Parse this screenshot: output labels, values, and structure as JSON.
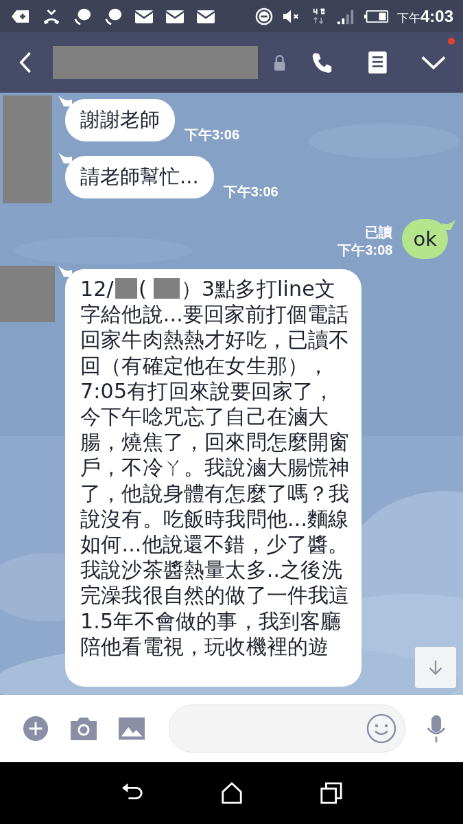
{
  "status_bar": {
    "time_prefix": "下午",
    "time": "4:03"
  },
  "header": {
    "has_notification": true
  },
  "messages": [
    {
      "kind": "incoming",
      "avatar": true,
      "parts": [
        {
          "kind": "text",
          "text": "謝謝老師"
        }
      ],
      "time": "下午3:06"
    },
    {
      "kind": "incoming",
      "avatar": false,
      "parts": [
        {
          "kind": "text",
          "text": "請老師幫忙..."
        }
      ],
      "time": "下午3:06"
    },
    {
      "kind": "outgoing",
      "parts": [
        {
          "kind": "text",
          "text": "ok"
        }
      ],
      "read_receipt": "已讀",
      "time": "下午3:08"
    },
    {
      "kind": "incoming",
      "avatar": true,
      "parts": [
        {
          "kind": "text",
          "text": "12/"
        },
        {
          "kind": "redacted"
        },
        {
          "kind": "text",
          "text": "("
        },
        {
          "kind": "redacted"
        },
        {
          "kind": "text",
          "text": "）3點多打line文字給他說...要回家前打個電話回家牛肉熱熱才好吃，已讀不回（有確定他在女生那），7:05有打回來說要回家了，今下午唸咒忘了自己在滷大腸，燒焦了，回來問怎麼開窗戶，不冷ㄚ。我說滷大腸慌神了，他說身體有怎麼了嗎？我說沒有。吃飯時我問他...麵線如何...他說還不錯，少了醬。我說沙茶醬熱量太多..之後洗完澡我很自然的做了一件我這1.5年不會做的事，我到客廳陪他看電視，玩收機裡的遊"
        }
      ]
    }
  ]
}
